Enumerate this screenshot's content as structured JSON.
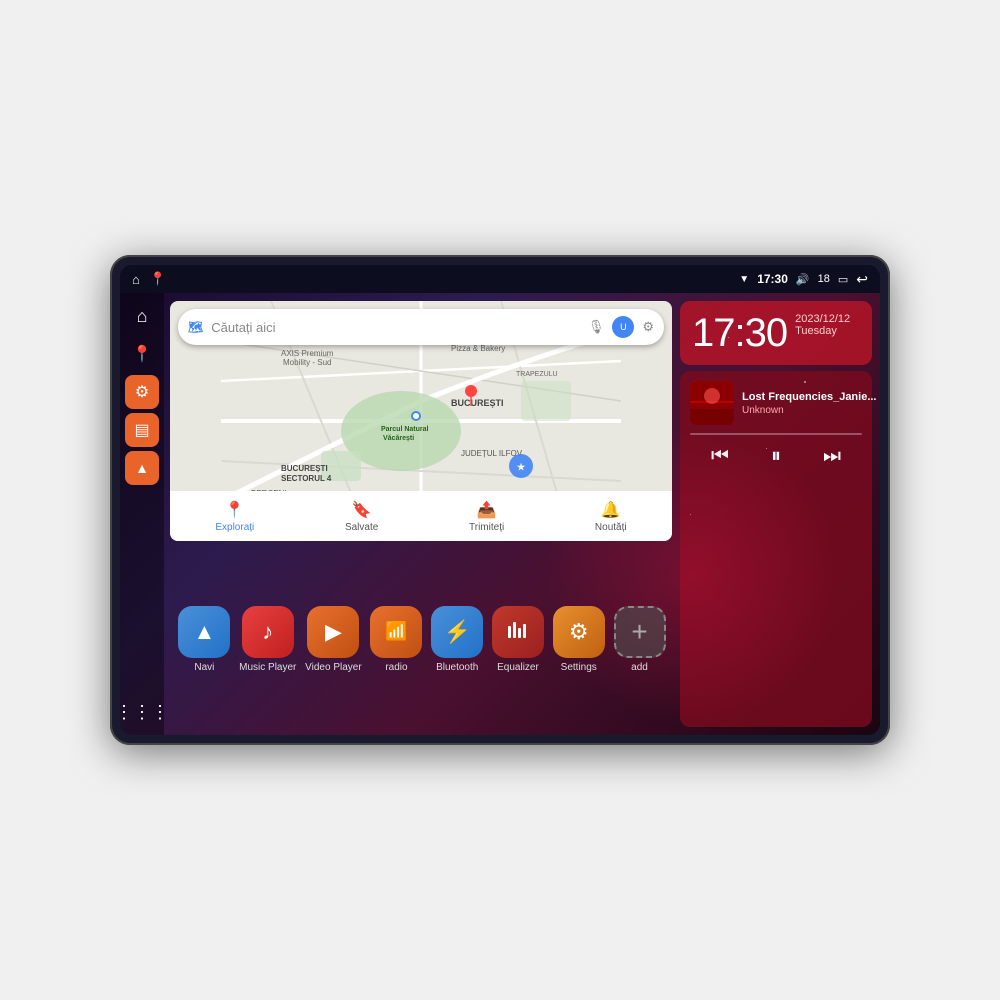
{
  "device": {
    "title": "Car Android Head Unit"
  },
  "statusBar": {
    "wifi_signal": "▼",
    "time": "17:30",
    "volume_icon": "🔊",
    "battery_level": "18",
    "battery_icon": "🔋",
    "back_icon": "↩"
  },
  "sidebar": {
    "icons": [
      {
        "name": "home",
        "symbol": "⌂",
        "label": "Home"
      },
      {
        "name": "maps",
        "symbol": "📍",
        "label": "Maps"
      },
      {
        "name": "settings",
        "symbol": "⚙",
        "label": "Settings",
        "color": "#e8642a"
      },
      {
        "name": "files",
        "symbol": "▤",
        "label": "Files",
        "color": "#e8642a"
      },
      {
        "name": "navigation",
        "symbol": "▲",
        "label": "Navigation",
        "color": "#e8642a"
      }
    ],
    "grid_label": "⋮⋮⋮"
  },
  "map": {
    "search_placeholder": "Căutați aici",
    "locations": [
      "AXIS Premium Mobility - Sud",
      "Pizza & Bakery",
      "Parcul Natural Văcărești",
      "BUCUREȘTI",
      "BUCUREȘTI SECTORUL 4",
      "JUDEȚUL ILFOV",
      "BERCENI"
    ],
    "nav_items": [
      {
        "label": "Explorați",
        "icon": "📍",
        "active": true
      },
      {
        "label": "Salvate",
        "icon": "🔖",
        "active": false
      },
      {
        "label": "Trimiteți",
        "icon": "📤",
        "active": false
      },
      {
        "label": "Noutăți",
        "icon": "🔔",
        "active": false
      }
    ]
  },
  "clock": {
    "time": "17:30",
    "date": "2023/12/12",
    "day": "Tuesday"
  },
  "music": {
    "title": "Lost Frequencies_Janie...",
    "artist": "Unknown",
    "prev_label": "⏮",
    "play_pause_label": "⏸",
    "next_label": "⏭"
  },
  "apps": [
    {
      "id": "navi",
      "label": "Navi",
      "icon": "▲",
      "bg": "#3a7bd5"
    },
    {
      "id": "music-player",
      "label": "Music Player",
      "icon": "♪",
      "bg": "#e8342a"
    },
    {
      "id": "video-player",
      "label": "Video Player",
      "icon": "▶",
      "bg": "#e87020"
    },
    {
      "id": "radio",
      "label": "radio",
      "icon": "📶",
      "bg": "#e87020"
    },
    {
      "id": "bluetooth",
      "label": "Bluetooth",
      "icon": "⚡",
      "bg": "#3a8fd5"
    },
    {
      "id": "equalizer",
      "label": "Equalizer",
      "icon": "▐▌",
      "bg": "#c0392b"
    },
    {
      "id": "settings",
      "label": "Settings",
      "icon": "⚙",
      "bg": "#e8962a"
    },
    {
      "id": "add",
      "label": "add",
      "icon": "+",
      "bg": "#555"
    }
  ],
  "colors": {
    "accent_orange": "#e8642a",
    "accent_red": "#c0392b",
    "accent_blue": "#3a7bd5",
    "bg_dark": "#0a0a1a",
    "sidebar_bg": "rgba(0,0,0,0.4)"
  }
}
